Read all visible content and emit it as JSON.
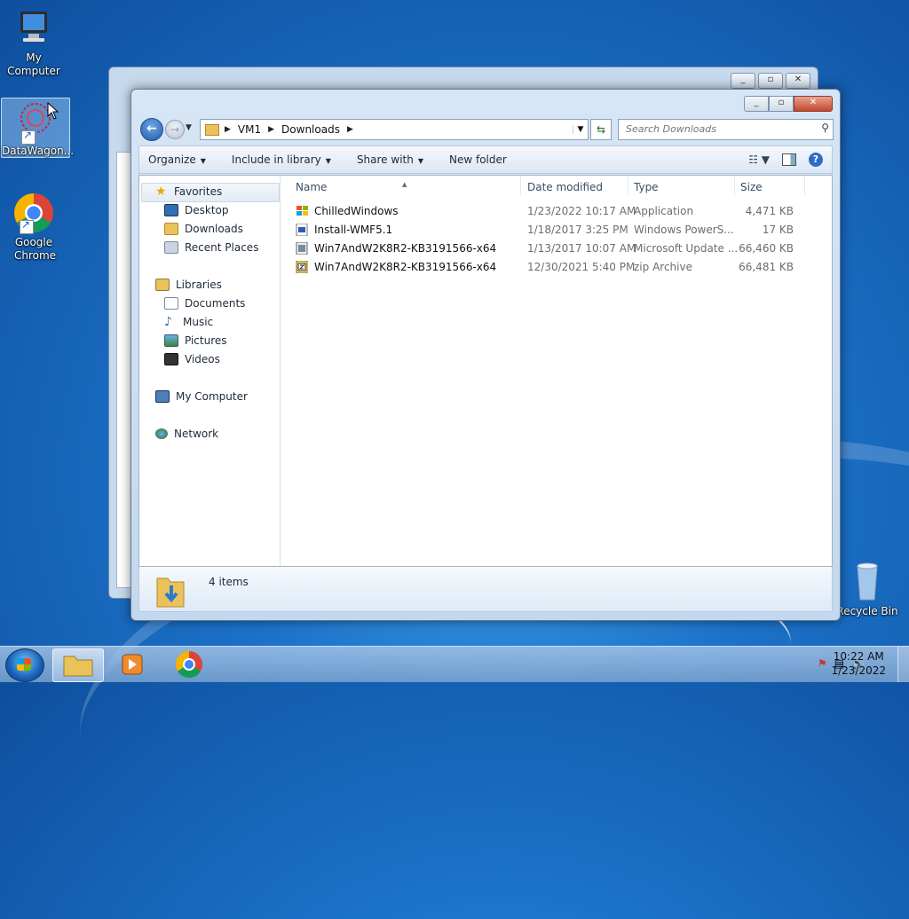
{
  "desktop": {
    "icons": [
      {
        "label": "My Computer"
      },
      {
        "label": "DataWagon..."
      },
      {
        "label": "Google Chrome"
      },
      {
        "label": "Recycle Bin"
      }
    ]
  },
  "explorer": {
    "breadcrumb": [
      "VM1",
      "Downloads"
    ],
    "search_placeholder": "Search Downloads",
    "toolbar": {
      "organize": "Organize",
      "include_in_library": "Include in library",
      "share_with": "Share with",
      "new_folder": "New folder"
    },
    "nav": {
      "favorites": "Favorites",
      "desktop": "Desktop",
      "downloads": "Downloads",
      "recent_places": "Recent Places",
      "libraries": "Libraries",
      "documents": "Documents",
      "music": "Music",
      "pictures": "Pictures",
      "videos": "Videos",
      "my_computer": "My Computer",
      "network": "Network"
    },
    "columns": {
      "name": "Name",
      "date": "Date modified",
      "type": "Type",
      "size": "Size"
    },
    "files": [
      {
        "name": "ChilledWindows",
        "date": "1/23/2022 10:17 AM",
        "type": "Application",
        "size": "4,471 KB",
        "icon": "application-icon"
      },
      {
        "name": "Install-WMF5.1",
        "date": "1/18/2017 3:25 PM",
        "type": "Windows PowerS...",
        "size": "17 KB",
        "icon": "powershell-script-icon"
      },
      {
        "name": "Win7AndW2K8R2-KB3191566-x64",
        "date": "1/13/2017 10:07 AM",
        "type": "Microsoft Update ...",
        "size": "66,460 KB",
        "icon": "update-package-icon"
      },
      {
        "name": "Win7AndW2K8R2-KB3191566-x64",
        "date": "12/30/2021 5:40 PM",
        "type": "zip Archive",
        "size": "66,481 KB",
        "icon": "zip-archive-icon"
      }
    ],
    "status": {
      "item_count": "4 items"
    }
  },
  "taskbar": {
    "clock_time": "10:22 AM",
    "clock_date": "1/23/2022"
  }
}
